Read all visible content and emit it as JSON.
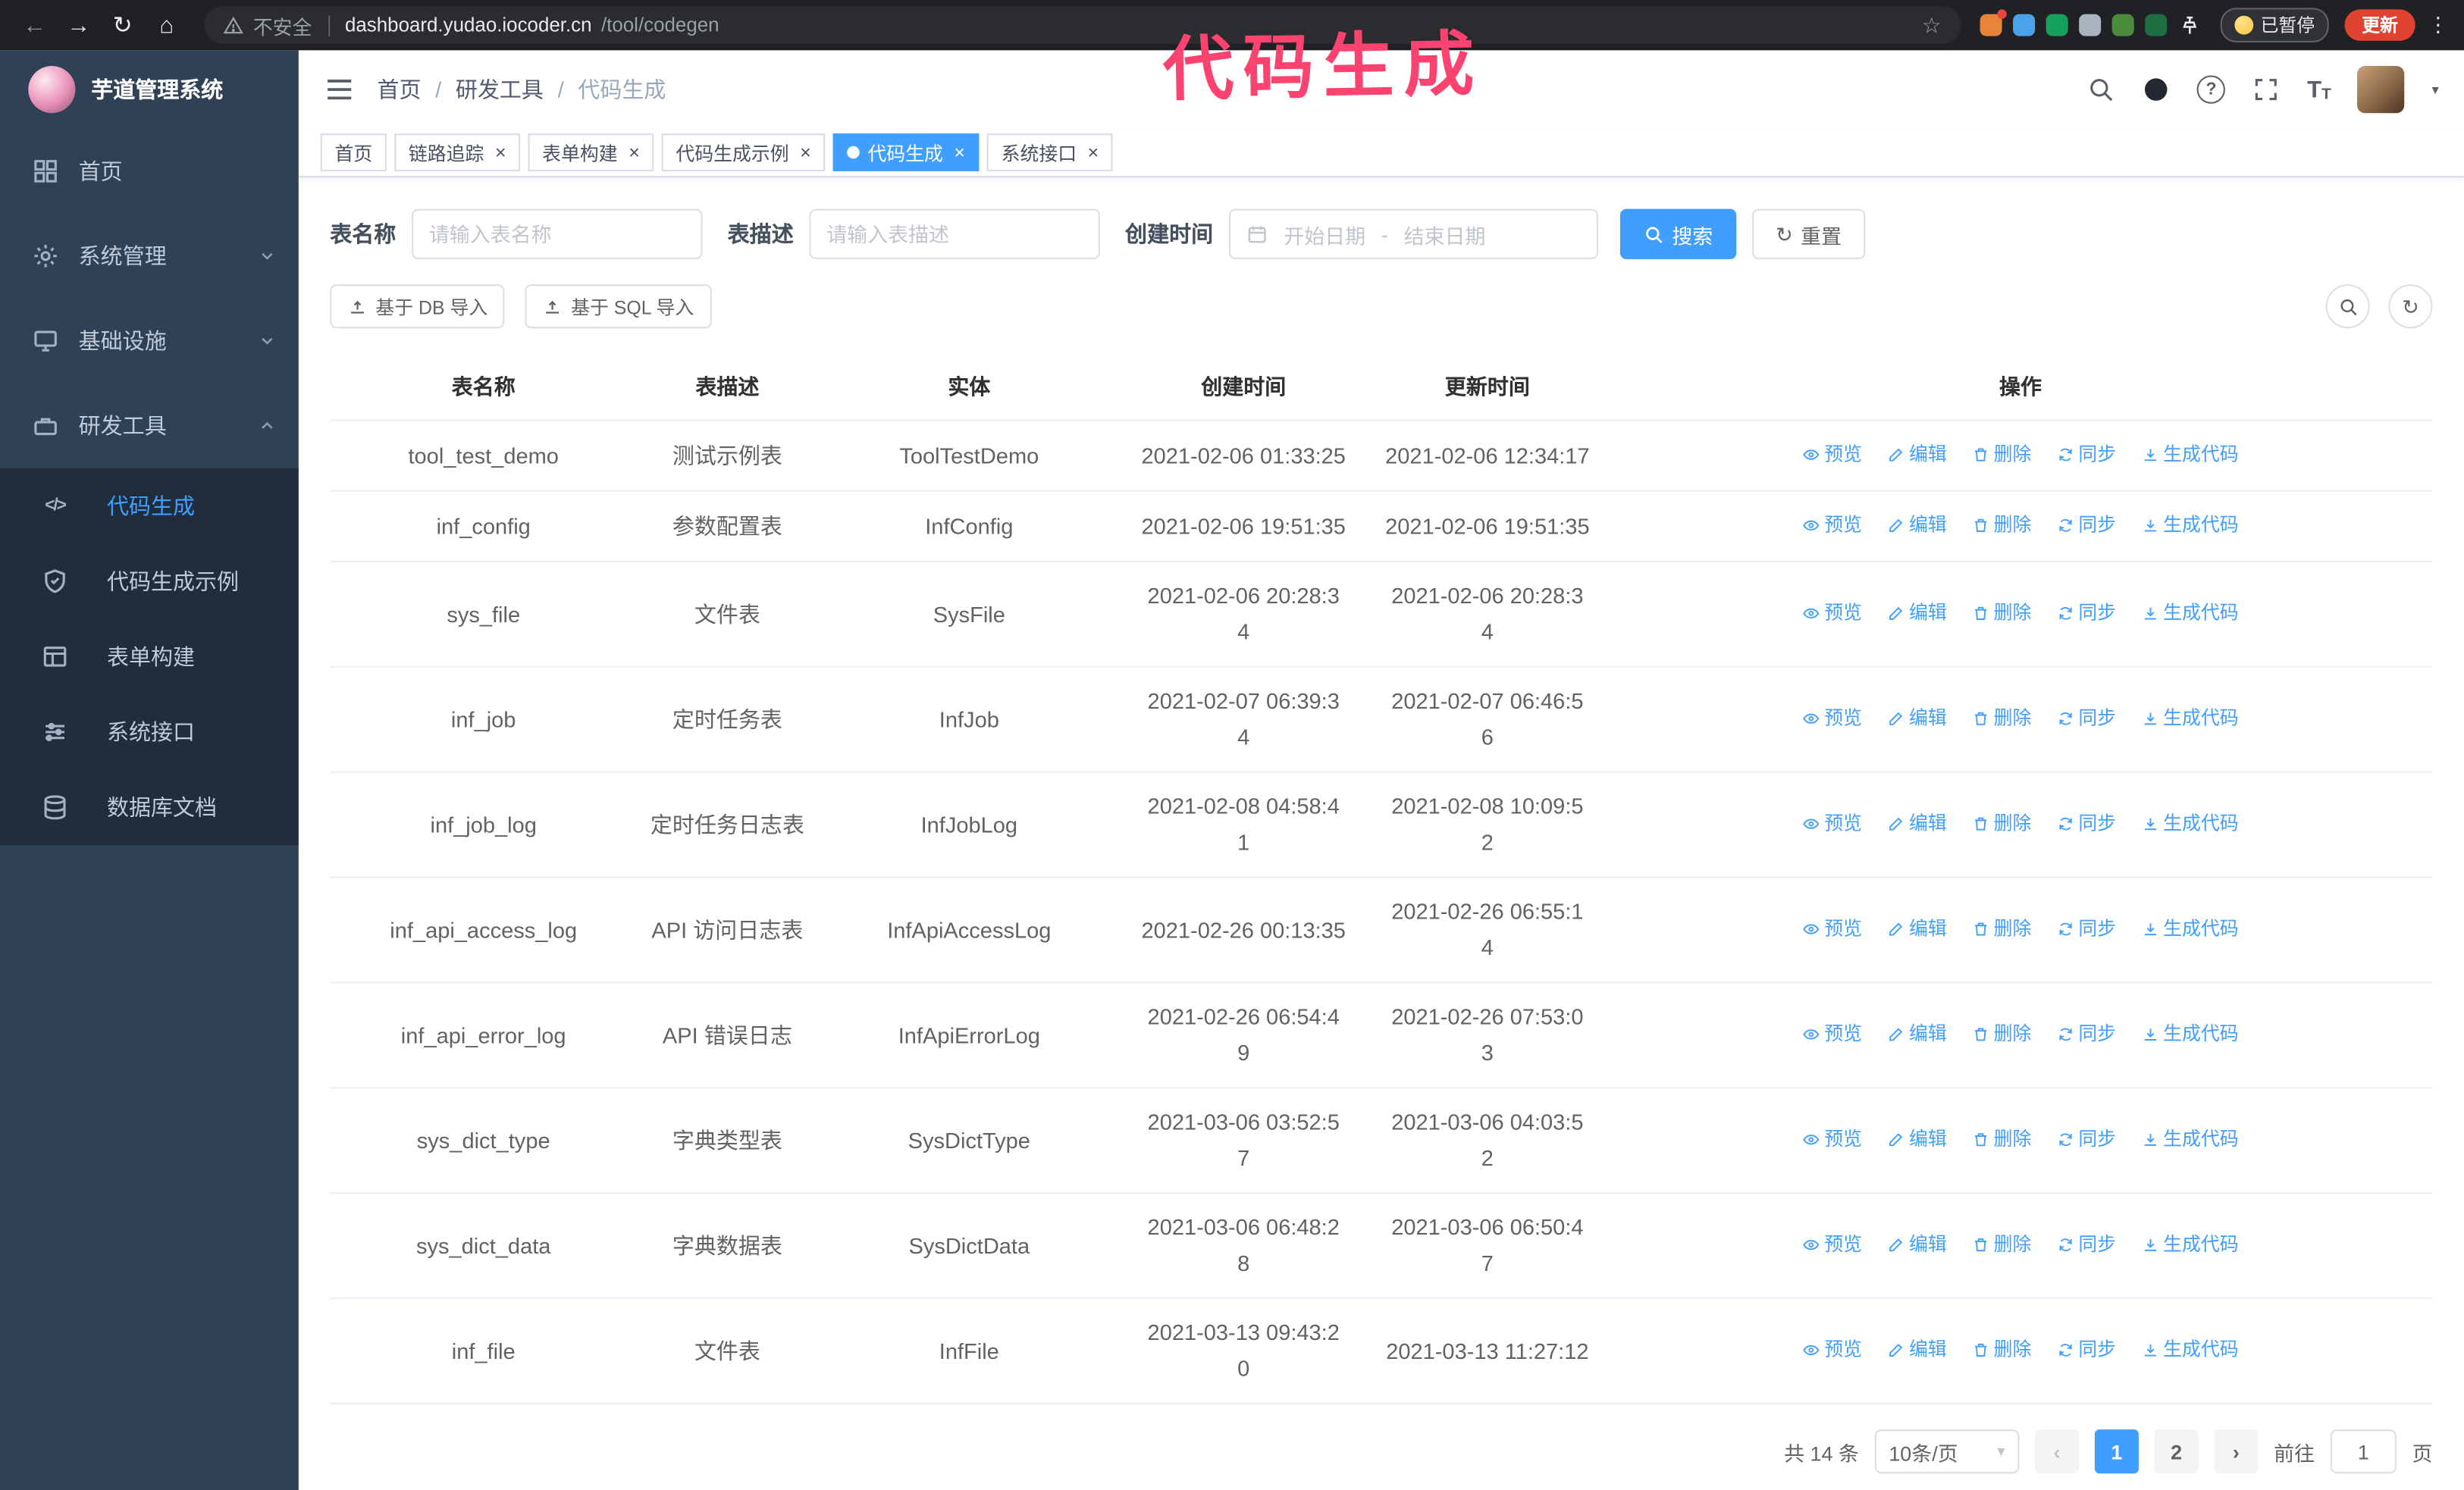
{
  "colors": {
    "accent": "#409eff",
    "sidebar_bg": "#304156",
    "submenu_bg": "#1f2d3d",
    "annotation": "#fc4370",
    "update_button_bg": "#e0432f",
    "browser_chrome_bg": "#202124"
  },
  "annotation": {
    "text": "代码生成"
  },
  "browser": {
    "security_label": "不安全",
    "url_host": "dashboard.yudao.iocoder.cn",
    "url_path": "/tool/codegen",
    "paused_badge": "已暂停",
    "update_button": "更新"
  },
  "icons": {
    "back": "←",
    "forward": "→",
    "reload": "↻",
    "home": "⌂",
    "star": "☆",
    "kebab": "⋮",
    "close": "×",
    "dropdown_caret": "▾",
    "prev_arrow": "‹",
    "next_arrow": "›",
    "refresh": "↻",
    "question": "?",
    "font_size_large": "T",
    "font_size_small": "T",
    "code": "</>"
  },
  "sidebar": {
    "app_title": "芋道管理系统",
    "items": [
      {
        "label": "首页"
      },
      {
        "label": "系统管理"
      },
      {
        "label": "基础设施"
      },
      {
        "label": "研发工具"
      }
    ],
    "subitems": [
      {
        "label": "代码生成",
        "active": true
      },
      {
        "label": "代码生成示例"
      },
      {
        "label": "表单构建"
      },
      {
        "label": "系统接口"
      },
      {
        "label": "数据库文档"
      }
    ]
  },
  "header": {
    "breadcrumb": [
      "首页",
      "研发工具",
      "代码生成"
    ],
    "separator": "/"
  },
  "tabs": [
    {
      "label": "首页"
    },
    {
      "label": "链路追踪",
      "closable": true
    },
    {
      "label": "表单构建",
      "closable": true
    },
    {
      "label": "代码生成示例",
      "closable": true
    },
    {
      "label": "代码生成",
      "closable": true,
      "active": true
    },
    {
      "label": "系统接口",
      "closable": true
    }
  ],
  "filters": {
    "table_name_label": "表名称",
    "table_name_placeholder": "请输入表名称",
    "table_desc_label": "表描述",
    "table_desc_placeholder": "请输入表描述",
    "create_time_label": "创建时间",
    "date_start_placeholder": "开始日期",
    "date_separator": "-",
    "date_end_placeholder": "结束日期",
    "search_button": "搜索",
    "reset_button": "重置"
  },
  "toolbar": {
    "import_db": "基于 DB 导入",
    "import_sql": "基于 SQL 导入"
  },
  "table": {
    "columns": [
      "表名称",
      "表描述",
      "实体",
      "创建时间",
      "更新时间",
      "操作"
    ],
    "row_actions": [
      "预览",
      "编辑",
      "删除",
      "同步",
      "生成代码"
    ],
    "rows": [
      {
        "name": "tool_test_demo",
        "desc": "测试示例表",
        "entity": "ToolTestDemo",
        "created": "2021-02-06 01:33:25",
        "updated": "2021-02-06 12:34:17"
      },
      {
        "name": "inf_config",
        "desc": "参数配置表",
        "entity": "InfConfig",
        "created": "2021-02-06 19:51:35",
        "updated": "2021-02-06 19:51:35"
      },
      {
        "name": "sys_file",
        "desc": "文件表",
        "entity": "SysFile",
        "created": "2021-02-06 20:28:3\n4",
        "updated": "2021-02-06 20:28:3\n4"
      },
      {
        "name": "inf_job",
        "desc": "定时任务表",
        "entity": "InfJob",
        "created": "2021-02-07 06:39:3\n4",
        "updated": "2021-02-07 06:46:5\n6"
      },
      {
        "name": "inf_job_log",
        "desc": "定时任务日志表",
        "entity": "InfJobLog",
        "created": "2021-02-08 04:58:4\n1",
        "updated": "2021-02-08 10:09:5\n2"
      },
      {
        "name": "inf_api_access_log",
        "desc": "API 访问日志表",
        "entity": "InfApiAccessLog",
        "created": "2021-02-26 00:13:35",
        "updated": "2021-02-26 06:55:1\n4"
      },
      {
        "name": "inf_api_error_log",
        "desc": "API 错误日志",
        "entity": "InfApiErrorLog",
        "created": "2021-02-26 06:54:4\n9",
        "updated": "2021-02-26 07:53:0\n3"
      },
      {
        "name": "sys_dict_type",
        "desc": "字典类型表",
        "entity": "SysDictType",
        "created": "2021-03-06 03:52:5\n7",
        "updated": "2021-03-06 04:03:5\n2"
      },
      {
        "name": "sys_dict_data",
        "desc": "字典数据表",
        "entity": "SysDictData",
        "created": "2021-03-06 06:48:2\n8",
        "updated": "2021-03-06 06:50:4\n7"
      },
      {
        "name": "inf_file",
        "desc": "文件表",
        "entity": "InfFile",
        "created": "2021-03-13 09:43:2\n0",
        "updated": "2021-03-13 11:27:12"
      }
    ]
  },
  "pagination": {
    "total": "共 14 条",
    "page_size": "10条/页",
    "page_1": "1",
    "page_2": "2",
    "goto_label": "前往",
    "goto_value": "1",
    "goto_unit": "页"
  }
}
